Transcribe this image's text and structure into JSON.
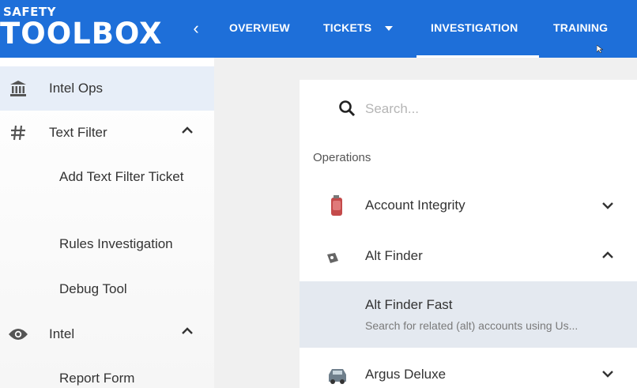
{
  "header": {
    "logo_top": "SAFETY",
    "logo_main": "TOOLBOX",
    "back": "‹",
    "nav": [
      {
        "label": "OVERVIEW"
      },
      {
        "label": "TICKETS"
      },
      {
        "label": "INVESTIGATION"
      },
      {
        "label": "TRAINING"
      }
    ],
    "active_tab": "INVESTIGATION",
    "color": "#1e6fd9"
  },
  "sidebar": {
    "items": [
      {
        "label": "Intel Ops",
        "icon": "bank-icon",
        "active": true
      },
      {
        "label": "Text Filter",
        "icon": "hash-icon",
        "expanded": true,
        "children": [
          "Add Text Filter Ticket",
          "Rules Investigation",
          "Debug Tool"
        ]
      },
      {
        "label": "Intel",
        "icon": "eye-icon",
        "expanded": true,
        "children": [
          "Report Form"
        ]
      }
    ]
  },
  "main": {
    "search": {
      "placeholder": "Search..."
    },
    "section": "Operations",
    "operations": [
      {
        "label": "Account Integrity",
        "icon": "fire-extinguisher-icon",
        "expanded": false
      },
      {
        "label": "Alt Finder",
        "icon": "tag-icon",
        "expanded": true,
        "children": [
          {
            "title": "Alt Finder Fast",
            "description": "Search for related (alt) accounts using Us..."
          }
        ]
      },
      {
        "label": "Argus Deluxe",
        "icon": "car-icon",
        "expanded": false
      }
    ]
  }
}
